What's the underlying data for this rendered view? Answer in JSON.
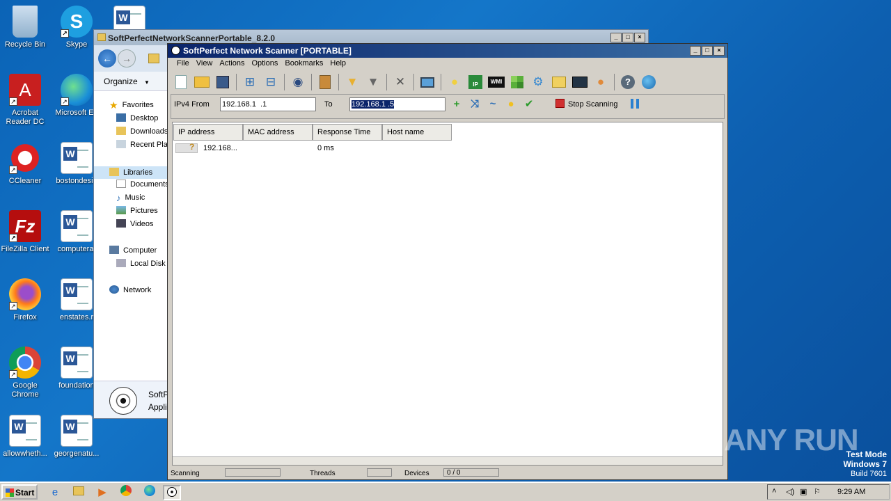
{
  "desktop": {
    "icons": [
      {
        "label": "Recycle Bin"
      },
      {
        "label": "Skype"
      },
      {
        "label": "Acrobat Reader DC"
      },
      {
        "label": "Microsoft Ed"
      },
      {
        "label": "CCleaner"
      },
      {
        "label": "bostondesig"
      },
      {
        "label": "FileZilla Client"
      },
      {
        "label": "computera."
      },
      {
        "label": "Firefox"
      },
      {
        "label": "enstates.r"
      },
      {
        "label": "Google Chrome"
      },
      {
        "label": "foundation"
      },
      {
        "label": "allowwheth..."
      },
      {
        "label": "georgenatu..."
      }
    ]
  },
  "explorer": {
    "title": "SoftPerfectNetworkScannerPortable_8.2.0",
    "organize": "Organize",
    "nav": {
      "favorites": "Favorites",
      "desktop": "Desktop",
      "downloads": "Downloads",
      "recent": "Recent Plac",
      "libraries": "Libraries",
      "documents": "Documents",
      "music": "Music",
      "pictures": "Pictures",
      "videos": "Videos",
      "computer": "Computer",
      "localdisk": "Local Disk (",
      "network": "Network"
    },
    "details": {
      "name": "SoftP",
      "type": "Applic"
    }
  },
  "app": {
    "title": "SoftPerfect Network Scanner [PORTABLE]",
    "menu": [
      "File",
      "View",
      "Actions",
      "Options",
      "Bookmarks",
      "Help"
    ],
    "range": {
      "from_label": "IPv4 From",
      "from_value": "192.168.1  .1",
      "to_label": "To",
      "to_value": "192.168.1  .5"
    },
    "stop_label": "Stop Scanning",
    "columns": [
      "IP address",
      "MAC address",
      "Response Time",
      "Host name"
    ],
    "rows": [
      {
        "ip": "192.168...",
        "mac": "",
        "response": "0 ms",
        "host": ""
      }
    ],
    "status": {
      "scanning": "Scanning",
      "threads": "Threads",
      "devices": "Devices",
      "devices_value": "0 / 0"
    }
  },
  "taskbar": {
    "start": "Start",
    "time": "9:29 AM"
  },
  "watermark": "ANY RUN",
  "testmode": {
    "line1": "Test Mode",
    "line2": "Windows 7",
    "line3": "Build 7601"
  }
}
